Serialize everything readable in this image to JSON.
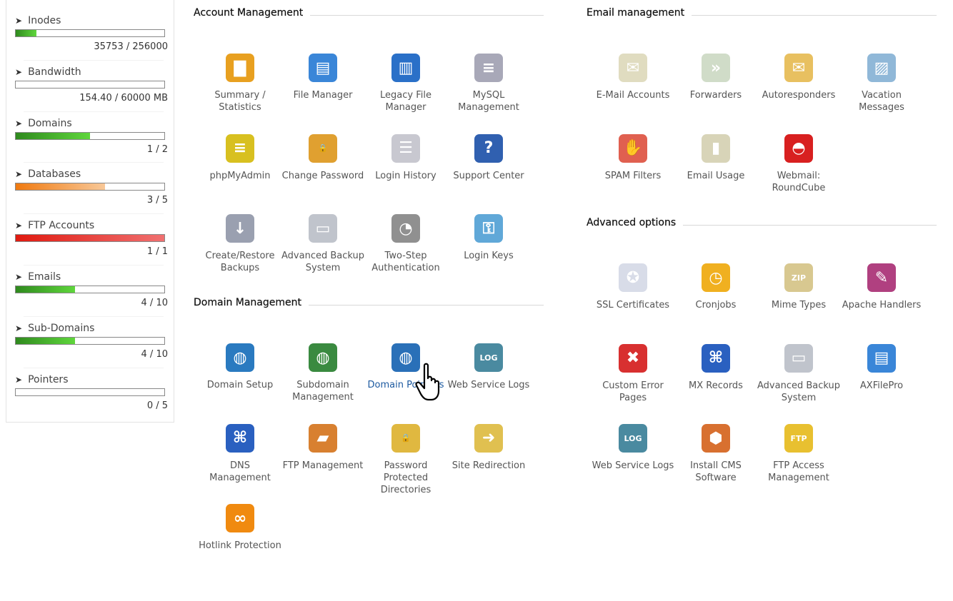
{
  "sidebar": {
    "stats": [
      {
        "label": "Inodes",
        "value": "35753 / 256000",
        "percent": 14,
        "color": "green"
      },
      {
        "label": "Bandwidth",
        "value": "154.40 / 60000 MB",
        "percent": 0,
        "color": "green"
      },
      {
        "label": "Domains",
        "value": "1 / 2",
        "percent": 50,
        "color": "green"
      },
      {
        "label": "Databases",
        "value": "3 / 5",
        "percent": 60,
        "color": "orange"
      },
      {
        "label": "FTP Accounts",
        "value": "1 / 1",
        "percent": 100,
        "color": "red"
      },
      {
        "label": "Emails",
        "value": "4 / 10",
        "percent": 40,
        "color": "green"
      },
      {
        "label": "Sub-Domains",
        "value": "4 / 10",
        "percent": 40,
        "color": "green"
      },
      {
        "label": "Pointers",
        "value": "0 / 5",
        "percent": 0,
        "color": "green"
      }
    ]
  },
  "colors": {
    "green": "#3fbf2a",
    "orange": "#f08a24",
    "red": "#e8281e",
    "link_hover": "#1d5aa0"
  },
  "sections": [
    {
      "title": "Account Management",
      "items": [
        {
          "label": "Summary / Statistics",
          "icon": "chart-icon",
          "bg": "#e8a020",
          "glyph": "▇"
        },
        {
          "label": "File Manager",
          "icon": "file-manager-icon",
          "bg": "#3a86d8",
          "glyph": "▤"
        },
        {
          "label": "Legacy File Manager",
          "icon": "legacy-file-manager-icon",
          "bg": "#2a70c8",
          "glyph": "▥"
        },
        {
          "label": "MySQL Management",
          "icon": "database-icon",
          "bg": "#a8a8b8",
          "glyph": "≡"
        },
        {
          "label": "phpMyAdmin",
          "icon": "phpmyadmin-icon",
          "bg": "#d8c020",
          "glyph": "≡"
        },
        {
          "label": "Change Password",
          "icon": "lock-icon",
          "bg": "#e0a030",
          "glyph": "🔒"
        },
        {
          "label": "Login History",
          "icon": "login-history-icon",
          "bg": "#c8c8d0",
          "glyph": "☰"
        },
        {
          "label": "Support Center",
          "icon": "support-icon",
          "bg": "#3060b0",
          "glyph": "?"
        },
        {
          "label": "Create/Restore Backups",
          "icon": "backup-icon",
          "bg": "#9aa0b0",
          "glyph": "↓"
        },
        {
          "label": "Advanced Backup System",
          "icon": "backup-drive-icon",
          "bg": "#c0c4cc",
          "glyph": "▭"
        },
        {
          "label": "Two-Step Authentication",
          "icon": "two-step-icon",
          "bg": "#909090",
          "glyph": "◔"
        },
        {
          "label": "Login Keys",
          "icon": "key-icon",
          "bg": "#60a8d8",
          "glyph": "⚿"
        }
      ]
    },
    {
      "title": "Domain Management",
      "items": [
        {
          "label": "Domain Setup",
          "icon": "globe-gear-icon",
          "bg": "#2a7ac0",
          "glyph": "◍"
        },
        {
          "label": "Subdomain Management",
          "icon": "globe-icon",
          "bg": "#3a8a40",
          "glyph": "◍"
        },
        {
          "label": "Domain Pointers",
          "icon": "globe-arrow-icon",
          "bg": "#2a70b8",
          "glyph": "◍",
          "hover": true
        },
        {
          "label": "Web Service Logs",
          "icon": "log-icon",
          "bg": "#4a8aa0",
          "glyph": "LOG"
        },
        {
          "label": "DNS Management",
          "icon": "dns-icon",
          "bg": "#2a60c0",
          "glyph": "⌘"
        },
        {
          "label": "FTP Management",
          "icon": "ftp-folder-icon",
          "bg": "#d88030",
          "glyph": "▰"
        },
        {
          "label": "Password Protected Directories",
          "icon": "locked-folder-icon",
          "bg": "#e0b840",
          "glyph": "🔒"
        },
        {
          "label": "Site Redirection",
          "icon": "redirect-icon",
          "bg": "#e0c050",
          "glyph": "➜"
        },
        {
          "label": "Hotlink Protection",
          "icon": "hotlink-lock-icon",
          "bg": "#f08a10",
          "glyph": "∞"
        }
      ]
    },
    {
      "title": "Email management",
      "items": [
        {
          "label": "E-Mail Accounts",
          "icon": "envelope-icon",
          "bg": "#e0dcc0",
          "glyph": "✉"
        },
        {
          "label": "Forwarders",
          "icon": "forward-envelope-icon",
          "bg": "#d0dcc8",
          "glyph": "»"
        },
        {
          "label": "Autoresponders",
          "icon": "autoresponder-icon",
          "bg": "#e8c060",
          "glyph": "✉"
        },
        {
          "label": "Vacation Messages",
          "icon": "vacation-icon",
          "bg": "#90b8d8",
          "glyph": "▨"
        },
        {
          "label": "SPAM Filters",
          "icon": "spam-filter-icon",
          "bg": "#e06050",
          "glyph": "✋"
        },
        {
          "label": "Email Usage",
          "icon": "email-usage-icon",
          "bg": "#d8d4b8",
          "glyph": "▮"
        },
        {
          "label": "Webmail: RoundCube",
          "icon": "roundcube-icon",
          "bg": "#d82020",
          "glyph": "◓"
        }
      ]
    },
    {
      "title": "Advanced options",
      "items": [
        {
          "label": "SSL Certificates",
          "icon": "certificate-icon",
          "bg": "#d8dce8",
          "glyph": "✪"
        },
        {
          "label": "Cronjobs",
          "icon": "clock-icon",
          "bg": "#f0b020",
          "glyph": "◷"
        },
        {
          "label": "Mime Types",
          "icon": "mime-icon",
          "bg": "#d8c890",
          "glyph": "ZIP"
        },
        {
          "label": "Apache Handlers",
          "icon": "apache-icon",
          "bg": "#b04080",
          "glyph": "✎"
        },
        {
          "label": "Custom Error Pages",
          "icon": "error-page-icon",
          "bg": "#d83030",
          "glyph": "✖"
        },
        {
          "label": "MX Records",
          "icon": "mx-icon",
          "bg": "#2a60c0",
          "glyph": "⌘"
        },
        {
          "label": "Advanced Backup System",
          "icon": "backup-drive-icon",
          "bg": "#c0c4cc",
          "glyph": "▭"
        },
        {
          "label": "AXFilePro",
          "icon": "axfilepro-icon",
          "bg": "#3a86d8",
          "glyph": "▤"
        },
        {
          "label": "Web Service Logs",
          "icon": "log-icon",
          "bg": "#4a8aa0",
          "glyph": "LOG"
        },
        {
          "label": "Install CMS Software",
          "icon": "cms-icon",
          "bg": "#d87030",
          "glyph": "⬢"
        },
        {
          "label": "FTP Access Management",
          "icon": "ftp-access-icon",
          "bg": "#e8c030",
          "glyph": "FTP"
        }
      ]
    }
  ]
}
